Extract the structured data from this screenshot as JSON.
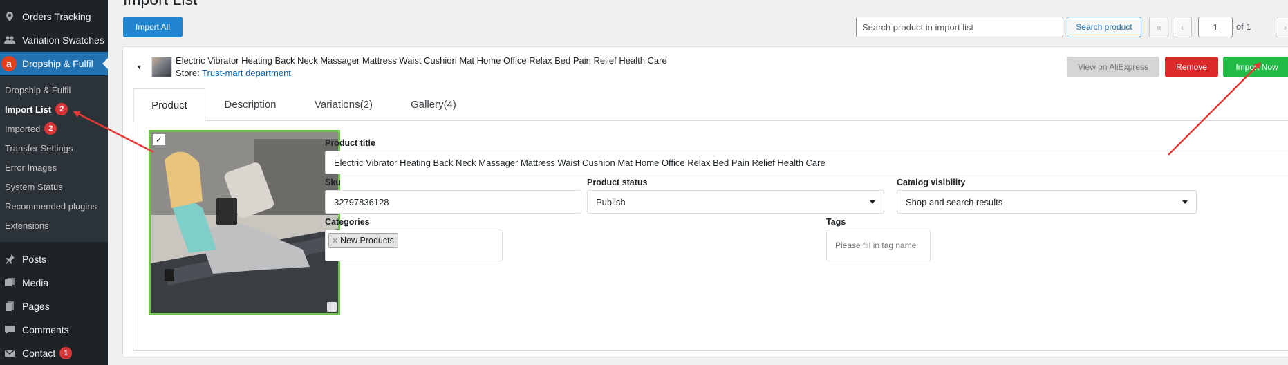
{
  "sidebar": {
    "top_items": [
      {
        "label": "Orders Tracking",
        "icon": "location-pin-icon"
      },
      {
        "label": "Variation Swatches",
        "icon": "users-icon"
      },
      {
        "label": "Dropship & Fulfil",
        "icon": "aliexpress-logo-icon"
      }
    ],
    "submenu": [
      {
        "label": "Dropship & Fulfil"
      },
      {
        "label": "Import List",
        "count": "2"
      },
      {
        "label": "Imported",
        "count": "2"
      },
      {
        "label": "Transfer Settings"
      },
      {
        "label": "Error Images"
      },
      {
        "label": "System Status"
      },
      {
        "label": "Recommended plugins"
      },
      {
        "label": "Extensions"
      }
    ],
    "bottom_items": [
      {
        "label": "Posts",
        "icon": "pin-icon"
      },
      {
        "label": "Media",
        "icon": "media-icon"
      },
      {
        "label": "Pages",
        "icon": "pages-icon"
      },
      {
        "label": "Comments",
        "icon": "comment-icon"
      },
      {
        "label": "Contact",
        "icon": "mail-icon",
        "count": "1"
      }
    ]
  },
  "header": {
    "title": "Import List",
    "import_all_label": "Import All",
    "search_placeholder": "Search product in import list",
    "search_button_label": "Search product",
    "pagination": {
      "first": "«",
      "prev": "‹",
      "current_page": "1",
      "of_label": "of 1",
      "next": "›"
    }
  },
  "product": {
    "name": "Electric Vibrator Heating Back Neck Massager Mattress Waist Cushion Mat Home Office Relax Bed Pain Relief Health Care",
    "store_label": "Store:",
    "store_name": "Trust-mart department",
    "view_on_aliexpress_label": "View on AliExpress",
    "remove_label": "Remove",
    "import_now_label": "Import Now",
    "tabs": [
      "Product",
      "Description",
      "Variations(2)",
      "Gallery(4)"
    ],
    "fields": {
      "title_label": "Product title",
      "title_value": "Electric Vibrator Heating Back Neck Massager Mattress Waist Cushion Mat Home Office Relax Bed Pain Relief Health Care",
      "sku_label": "Sku",
      "sku_value": "32797836128",
      "status_label": "Product status",
      "status_value": "Publish",
      "visibility_label": "Catalog visibility",
      "visibility_value": "Shop and search results",
      "categories_label": "Categories",
      "category_chips": [
        "New Products"
      ],
      "chip_remove": "×",
      "tags_label": "Tags",
      "tags_placeholder": "Please fill in tag name"
    },
    "image_checkbox": "✓"
  },
  "colors": {
    "sidebar_bg": "#1d2327",
    "submenu_bg": "#2c3338",
    "current_menu": "#2271b1",
    "primary_button": "#2185d0",
    "remove_button": "#db2828",
    "import_now_button": "#21ba45",
    "image_border": "#6cc644",
    "annotation_arrow": "#e53935",
    "badge": "#d63638"
  }
}
